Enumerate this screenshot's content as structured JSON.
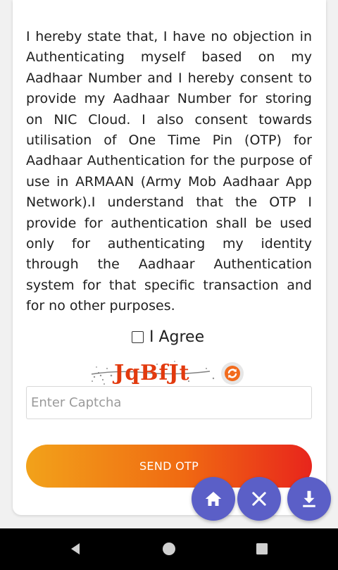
{
  "consent": {
    "text": "I hereby state that, I have no objection in Authenticating myself based on my Aadhaar Number and I hereby consent to provide my Aadhaar Number for storing on NIC Cloud. I also consent towards utilisation of One Time Pin (OTP) for Aadhaar Authentication for the purpose of use in ARMAAN (Army Mob Aadhaar App Network).I understand that the OTP I provide for authentication shall be used only for authenticating my identity through the Aadhaar Authentication system for that specific transaction and for no other purposes."
  },
  "agree": {
    "label": "I Agree",
    "checked": false
  },
  "captcha": {
    "code": "JqBfJt",
    "input_placeholder": "Enter Captcha",
    "input_value": "",
    "refresh_icon": "refresh-icon"
  },
  "send_otp": {
    "label": "SEND OTP"
  },
  "fabs": {
    "home_icon": "home-icon",
    "close_icon": "close-icon",
    "download_icon": "download-icon",
    "color": "#5b5fc7"
  },
  "colors": {
    "button_gradient_start": "#f2a21a",
    "button_gradient_end": "#e8251c",
    "captcha_text": "#e23a0e"
  },
  "navbar": {
    "back_icon": "back-triangle-icon",
    "home_icon": "home-circle-icon",
    "recent_icon": "recent-square-icon"
  }
}
